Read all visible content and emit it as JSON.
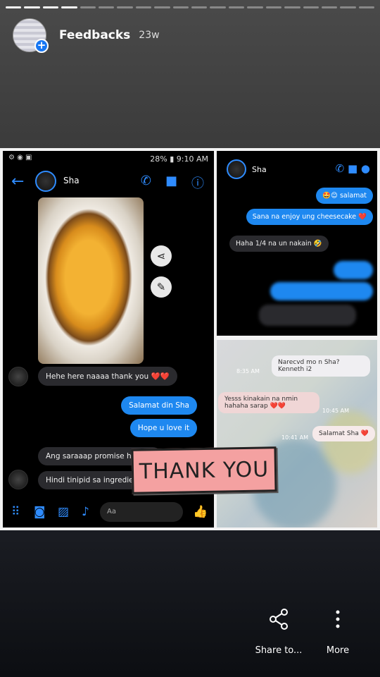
{
  "story": {
    "segments_total": 20,
    "segments_done": 4,
    "owner": "Feedbacks",
    "age": "23w"
  },
  "chat_main": {
    "status_right": "28% ▮ 9:10 AM",
    "contact": "Sha",
    "messages": [
      {
        "dir": "in",
        "text": "Hehe here naaaa thank you ❤️❤️"
      },
      {
        "dir": "out",
        "text": "Salamat din Sha"
      },
      {
        "dir": "out",
        "text": "Hope u love it"
      },
      {
        "dir": "in",
        "text": "Ang saraaap promise hahaha"
      },
      {
        "dir": "in",
        "text": "Hindi tinipid sa ingredients 😊"
      }
    ],
    "composer_placeholder": "Aa"
  },
  "chat_top_right": {
    "contact": "Sha",
    "messages": [
      {
        "dir": "out",
        "text": "🤩😊 salamat"
      },
      {
        "dir": "out",
        "text": "Sana na enjoy ung cheesecake ❤️"
      },
      {
        "dir": "in",
        "text": "Haha 1/4 na un nakain 🤣"
      }
    ]
  },
  "chat_bottom_right": {
    "messages": [
      {
        "dir": "out",
        "text": "Narecvd mo n Sha? Kenneth i2",
        "time": "8:35 AM"
      },
      {
        "dir": "in",
        "text": "Yesss kinakain na nmin hahaha sarap ❤️❤️",
        "time": "10:45 AM"
      },
      {
        "dir": "out",
        "text": "Salamat Sha ❤️",
        "time": "10:41 AM"
      }
    ]
  },
  "sticker": {
    "text": "THANK YOU"
  },
  "actions": [
    {
      "label": "Share to...",
      "icon": "share-icon"
    },
    {
      "label": "More",
      "icon": "more-vertical-icon"
    }
  ],
  "colors": {
    "messenger_blue": "#1e88f0",
    "sticker_pink": "#f4a1a1"
  }
}
